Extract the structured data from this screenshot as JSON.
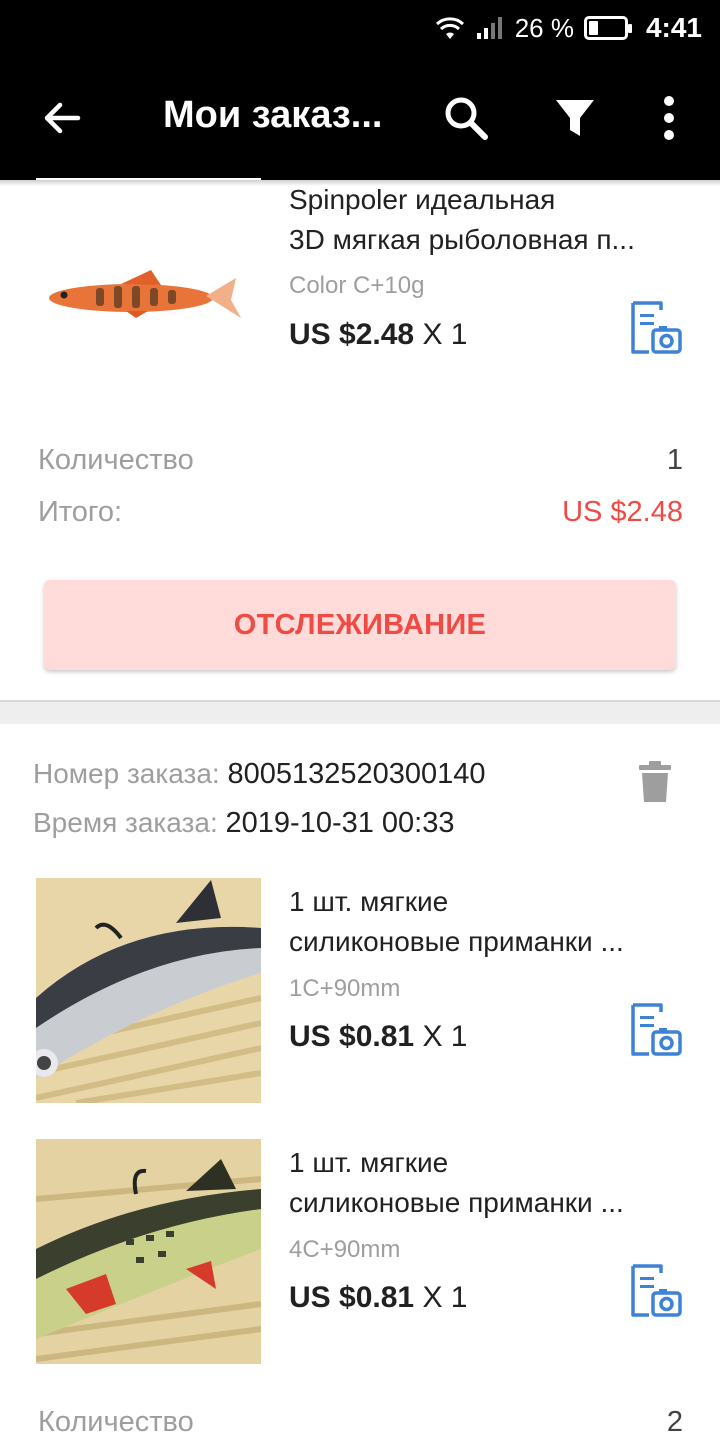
{
  "status_bar": {
    "battery": "26 %",
    "battery_level": 0.26,
    "time": "4:41"
  },
  "appbar": {
    "title": "Мои заказ...",
    "icons": [
      "back-arrow-icon",
      "search-icon",
      "filter-icon",
      "more-vert-icon"
    ]
  },
  "order1": {
    "item": {
      "name_line1": "Spinpoler идеальная",
      "name_line2": "3D мягкая рыболовная п...",
      "variant": "Color C+10g",
      "price": "US $2.48",
      "qty_text": "X 1"
    },
    "quantity_label": "Количество",
    "quantity_value": "1",
    "total_label": "Итого:",
    "total_value": "US $2.48",
    "track_label": "ОТСЛЕЖИВАНИЕ"
  },
  "order2": {
    "number_label": "Номер заказа:",
    "number_value": "8005132520300140",
    "time_label": "Время заказа:",
    "time_value": "2019-10-31 00:33",
    "items": [
      {
        "name_line1": "1 шт. мягкие",
        "name_line2": "силиконовые приманки ...",
        "variant": "1C+90mm",
        "price": "US $0.81",
        "qty_text": "X 1"
      },
      {
        "name_line1": "1 шт. мягкие",
        "name_line2": "силиконовые приманки ...",
        "variant": "4C+90mm",
        "price": "US $0.81",
        "qty_text": "X 1"
      }
    ],
    "quantity_label": "Количество",
    "quantity_value": "2"
  },
  "colors": {
    "accent_red": "#f04a44",
    "button_bg": "#ffdcda",
    "icon_blue": "#3d82d6"
  }
}
